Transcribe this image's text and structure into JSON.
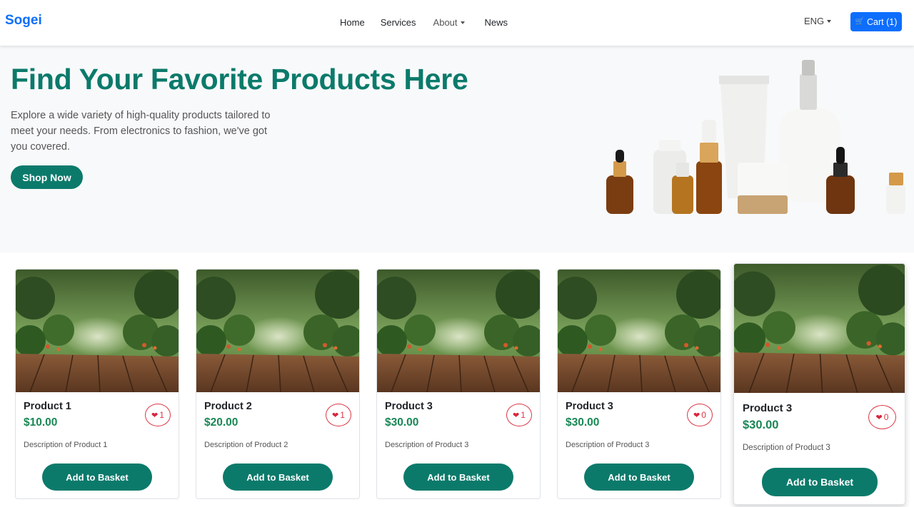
{
  "navbar": {
    "brand": "Sogei",
    "links": [
      {
        "label": "Home"
      },
      {
        "label": "Services"
      },
      {
        "label": "About"
      },
      {
        "label": "News"
      }
    ],
    "language": "ENG",
    "cart_label": "Cart (1)"
  },
  "hero": {
    "title": "Find Your Favorite Products Here",
    "text": "Explore a wide variety of high-quality products tailored to meet your needs. From electronics to fashion, we've got you covered.",
    "button": "Shop Now"
  },
  "products": [
    {
      "name": "Product 1",
      "price": "$10.00",
      "likes": "1",
      "description": "Description of Product 1",
      "button": "Add to Basket"
    },
    {
      "name": "Product 2",
      "price": "$20.00",
      "likes": "1",
      "description": "Description of Product 2",
      "button": "Add to Basket"
    },
    {
      "name": "Product 3",
      "price": "$30.00",
      "likes": "1",
      "description": "Description of Product 3",
      "button": "Add to Basket"
    },
    {
      "name": "Product 3",
      "price": "$30.00",
      "likes": "0",
      "description": "Description of Product 3",
      "button": "Add to Basket"
    },
    {
      "name": "Product 3",
      "price": "$30.00",
      "likes": "0",
      "description": "Description of Product 3",
      "button": "Add to Basket"
    }
  ],
  "colors": {
    "brand": "#0d6efd",
    "accent": "#0b7a6b",
    "price": "#198754",
    "like": "#dc3545"
  }
}
